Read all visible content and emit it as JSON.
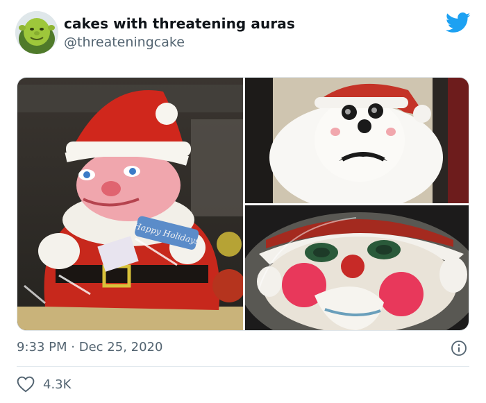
{
  "tweet": {
    "display_name": "cakes with threatening auras",
    "handle": "@threateningcake",
    "time": "9:33 PM",
    "separator": "·",
    "date": "Dec 25, 2020",
    "like_count": "4.3K"
  },
  "media": {
    "cake_text": "Happy Holidays",
    "images": [
      {
        "subject": "santa-cake-standing"
      },
      {
        "subject": "santa-cake-black-eyes"
      },
      {
        "subject": "santa-cake-clown-face"
      }
    ]
  },
  "icons": {
    "brand": "twitter-bird-icon",
    "info": "info-icon",
    "like": "heart-icon"
  },
  "colors": {
    "brand": "#1da1f2",
    "text_primary": "#0f1419",
    "text_secondary": "#536471",
    "divider": "#e1e8ed"
  }
}
